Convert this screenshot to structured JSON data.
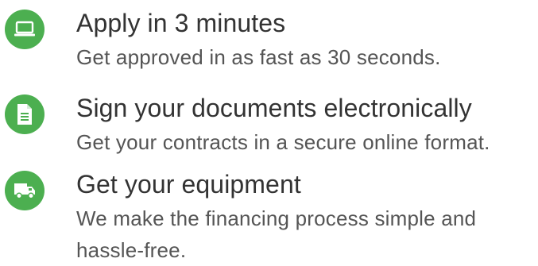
{
  "colors": {
    "accent": "#4caf50",
    "title": "#333333",
    "description": "#555555"
  },
  "steps": [
    {
      "icon": "laptop-icon",
      "title": "Apply in 3 minutes",
      "description": "Get approved in as fast as 30 seconds."
    },
    {
      "icon": "document-icon",
      "title": "Sign your documents electronically",
      "description": "Get your contracts in a secure online format."
    },
    {
      "icon": "truck-icon",
      "title": "Get your equipment",
      "description": "We make the financing process simple and hassle-free."
    }
  ]
}
